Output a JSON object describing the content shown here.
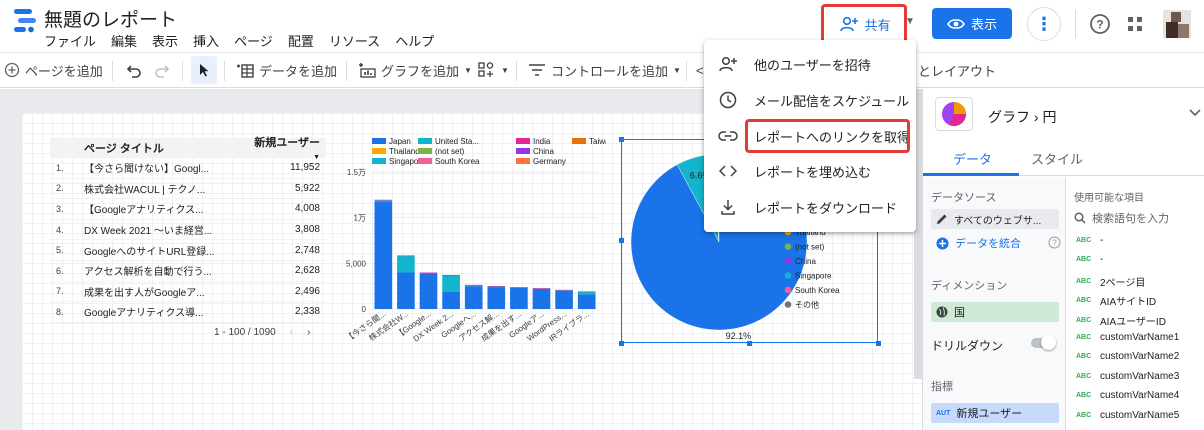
{
  "app": {
    "title": "無題のレポート",
    "menu": [
      "ファイル",
      "編集",
      "表示",
      "挿入",
      "ページ",
      "配置",
      "リソース",
      "ヘルプ"
    ],
    "share_label": "共有",
    "view_label": "表示"
  },
  "toolbar": {
    "add_page": "ページを追加",
    "add_data": "データを追加",
    "add_chart": "グラフを追加",
    "add_control": "コントロールを追加",
    "layout_fragment": "とレイアウト"
  },
  "share_menu": {
    "items": [
      {
        "label": "他のユーザーを招待",
        "icon": "person-add-icon"
      },
      {
        "label": "メール配信をスケジュール",
        "icon": "clock-icon"
      },
      {
        "label": "レポートへのリンクを取得",
        "icon": "link-icon"
      },
      {
        "label": "レポートを埋め込む",
        "icon": "code-icon"
      },
      {
        "label": "レポートをダウンロード",
        "icon": "download-icon"
      }
    ]
  },
  "table": {
    "col_title": "ページ タイトル",
    "col_metric": "新規ユーザー",
    "rows": [
      {
        "idx": "1.",
        "name": "【今さら聞けない】Googl...",
        "value": "11,952"
      },
      {
        "idx": "2.",
        "name": "株式会社WACUL | テクノ...",
        "value": "5,922"
      },
      {
        "idx": "3.",
        "name": "【Googleアナリティクス...",
        "value": "4,008"
      },
      {
        "idx": "4.",
        "name": "DX Week 2021 〜いま経営...",
        "value": "3,808"
      },
      {
        "idx": "5.",
        "name": "GoogleへのサイトURL登録...",
        "value": "2,748"
      },
      {
        "idx": "6.",
        "name": "アクセス解析を自動で行う...",
        "value": "2,628"
      },
      {
        "idx": "7.",
        "name": "成果を出す人がGoogleア...",
        "value": "2,496"
      },
      {
        "idx": "8.",
        "name": "Googleアナリティクス導...",
        "value": "2,338"
      }
    ],
    "pagination": "1 - 100 / 1090"
  },
  "chart_data": [
    {
      "type": "bar",
      "stacked": true,
      "legend": [
        {
          "name": "Japan",
          "color": "#1a73e8"
        },
        {
          "name": "United Sta...",
          "color": "#12b5cb"
        },
        {
          "name": "India",
          "color": "#e52592"
        },
        {
          "name": "Taiwan",
          "color": "#e8710a"
        },
        {
          "name": "Thailand",
          "color": "#f9ab00"
        },
        {
          "name": "(not set)",
          "color": "#7cb342"
        },
        {
          "name": "China",
          "color": "#9334e6"
        },
        {
          "name": "Singapore",
          "color": "#12b5cb"
        },
        {
          "name": "South Korea",
          "color": "#f06292"
        },
        {
          "name": "Germany",
          "color": "#ff7043"
        }
      ],
      "y_ticks": [
        "1.5万",
        "1万",
        "5,000",
        "0"
      ],
      "categories": [
        "【今さら聞...",
        "株式会社W...",
        "【Google...",
        "DX Week 2...",
        "Googleへ...",
        "アクセス解...",
        "成果を出す...",
        "Googleア...",
        "WordPress...",
        "IRライブラ..."
      ],
      "series": [
        {
          "name": "Japan",
          "values": [
            11800,
            4000,
            3900,
            1900,
            2500,
            2400,
            2300,
            2200,
            2000,
            1600
          ]
        },
        {
          "name": "United Sta...",
          "values": [
            100,
            1800,
            60,
            1800,
            100,
            80,
            60,
            50,
            80,
            300
          ]
        },
        {
          "name": "India",
          "values": [
            60,
            60,
            30,
            30,
            40,
            40,
            30,
            30,
            20,
            20
          ]
        }
      ],
      "ylim": [
        0,
        15000
      ]
    },
    {
      "type": "pie",
      "slices": [
        {
          "name": "Japan",
          "value": 92.1,
          "label": "92.1%",
          "color": "#1a73e8"
        },
        {
          "name": "United Sta...",
          "value": 6.6,
          "label": "6.6%",
          "color": "#12b5cb"
        },
        {
          "name": "India",
          "value": 0.5,
          "color": "#e52592"
        },
        {
          "name": "Taiwan",
          "value": 0.3,
          "color": "#e8710a"
        },
        {
          "name": "Thailand",
          "value": 0.2,
          "color": "#f9ab00"
        },
        {
          "name": "(not set)",
          "value": 0.1,
          "color": "#7cb342"
        },
        {
          "name": "China",
          "value": 0.1,
          "color": "#9334e6"
        },
        {
          "name": "Singapore",
          "value": 0.05,
          "color": "#12b5cb"
        },
        {
          "name": "South Korea",
          "value": 0.03,
          "color": "#f06292"
        },
        {
          "name": "その他",
          "value": 0.02,
          "color": "#757575"
        }
      ],
      "legend_visible": [
        "Thailand",
        "(not set)",
        "China",
        "Singapore",
        "South Korea",
        "その他"
      ]
    }
  ],
  "panel": {
    "chart_type": "グラフ › 円",
    "tab_data": "データ",
    "tab_style": "スタイル",
    "data_source_label": "データソース",
    "data_source_value": "すべてのウェブサ...",
    "blend_label": "データを統合",
    "dimension_label": "ディメンション",
    "dimension_value": "国",
    "drilldown_label": "ドリルダウン",
    "metric_label": "指標",
    "metric_value": "新規ユーザー",
    "metric_tag": "AUT",
    "available_label": "使用可能な項目",
    "search_placeholder": "検索語句を入力",
    "fields": [
      "-",
      "-",
      "2ページ目",
      "AIAサイトID",
      "AIAユーザーID",
      "customVarName1",
      "customVarName2",
      "customVarName3",
      "customVarName4",
      "customVarName5"
    ]
  },
  "colors": {
    "accent": "#1a73e8",
    "highlight": "#e53935"
  }
}
